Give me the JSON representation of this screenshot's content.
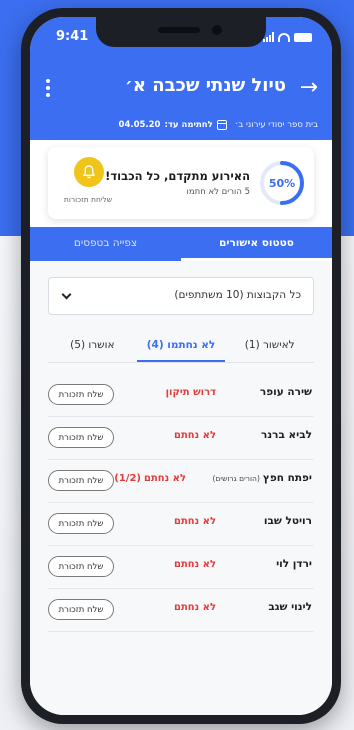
{
  "status_bar": {
    "time": "9:41"
  },
  "header": {
    "title": "טיול שנתי שכבה א׳",
    "school": "בית ספר יסודי עירוני ב׳",
    "deadline_label": "לחתימה עד:",
    "deadline_date": "04.05.20"
  },
  "summary_card": {
    "progress_label": "50%",
    "progress_value": 0.5,
    "headline": "האירוע מתקדם, כל הכבוד!",
    "subtext": "5 הורים לא חתמו",
    "reminder_label": "שליחת תזכורות"
  },
  "main_tabs": [
    {
      "label": "סטטוס אישורים",
      "active": true
    },
    {
      "label": "צפייה בטפסים",
      "active": false
    }
  ],
  "group_select": {
    "value": "כל הקבוצות (10 משתתפים)"
  },
  "sub_tabs": [
    {
      "label": "לאישור (1)",
      "active": false
    },
    {
      "label": "לא נחתמו (4)",
      "active": true
    },
    {
      "label": "אושרו (5)",
      "active": false
    }
  ],
  "participants": [
    {
      "name": "שירה עופר",
      "note": "",
      "status": "דרוש תיקון",
      "count": "",
      "action": "שלח תזכורת"
    },
    {
      "name": "לביא ברנר",
      "note": "",
      "status": "לא נחתם",
      "count": "",
      "action": "שלח תזכורת"
    },
    {
      "name": "יפתח חפץ",
      "note": "(הורים גרושים)",
      "status": "לא נחתם",
      "count": "(1/2)",
      "action": "שלח תזכורת"
    },
    {
      "name": "רויטל שבו",
      "note": "",
      "status": "לא נחתם",
      "count": "",
      "action": "שלח תזכורת"
    },
    {
      "name": "ירדן לוי",
      "note": "",
      "status": "לא נחתם",
      "count": "",
      "action": "שלח תזכורת"
    },
    {
      "name": "לינוי שגב",
      "note": "",
      "status": "לא נחתם",
      "count": "",
      "action": "שלח תזכורת"
    }
  ],
  "colors": {
    "brand": "#3b6ef0",
    "alert": "#e43c3c",
    "bell": "#f0c419"
  }
}
